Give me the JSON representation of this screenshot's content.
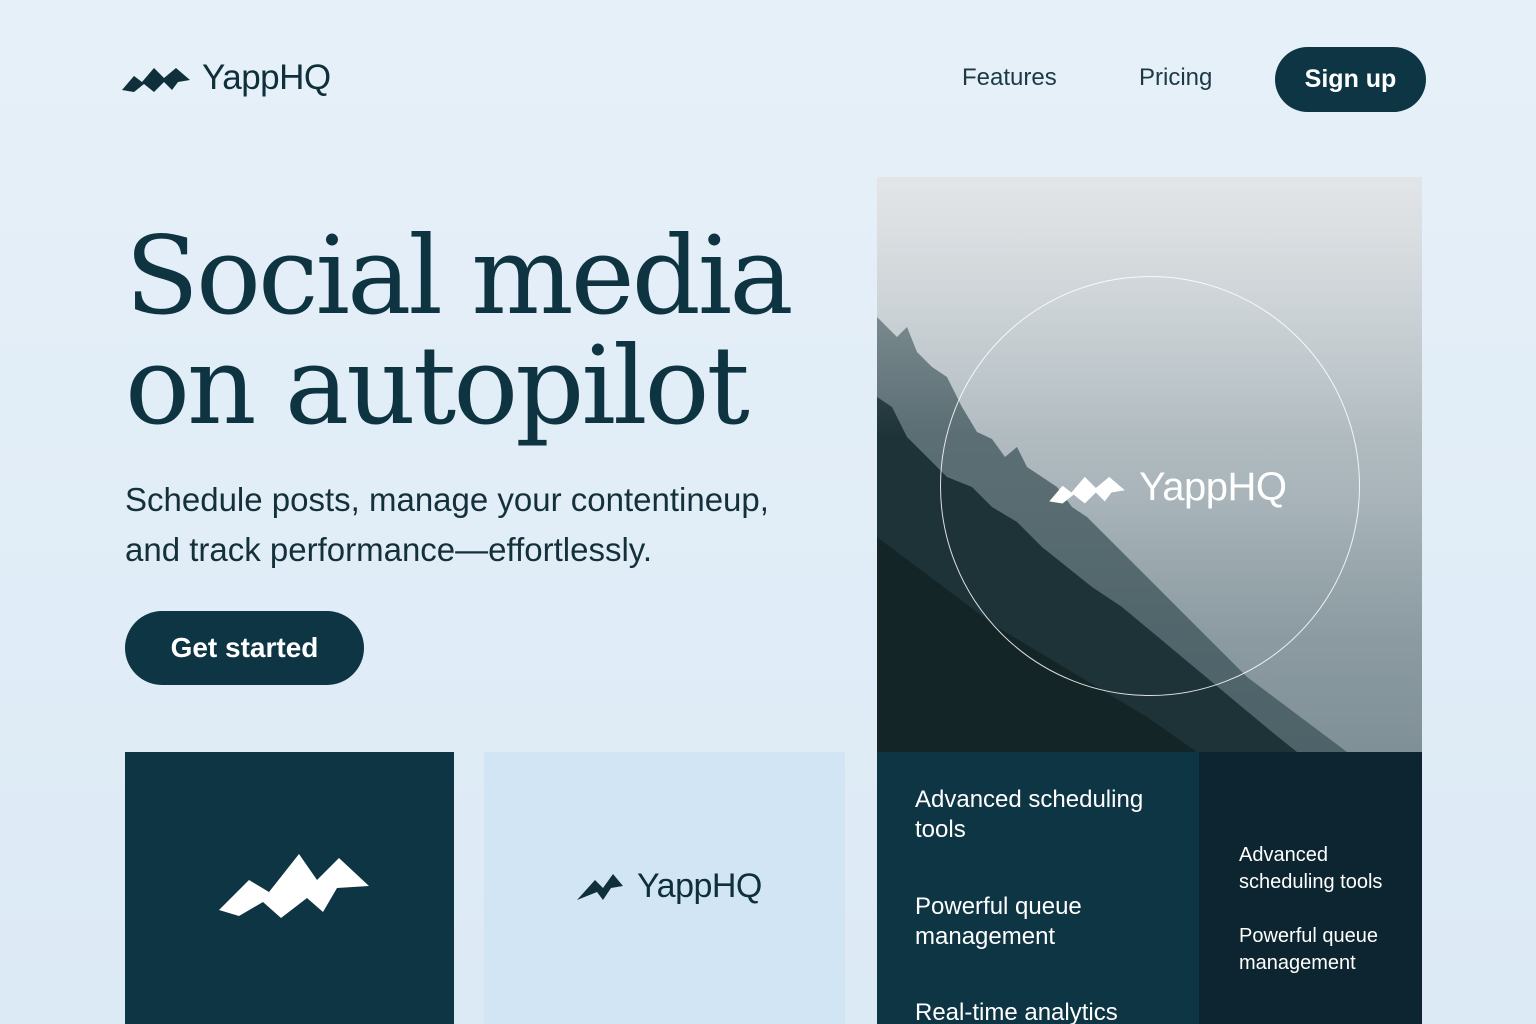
{
  "brand": {
    "name": "YappHQ",
    "primary_color": "#0e3544",
    "background_color": "#e2eef8"
  },
  "nav": {
    "features_label": "Features",
    "pricing_label": "Pricing",
    "signup_label": "Sign up"
  },
  "hero": {
    "headline_line1": "Social media",
    "headline_line2": "on autopilot",
    "subtext_line1": "Schedule posts, manage your contentineup,",
    "subtext_line2": "and track performance—effortlessly.",
    "cta_label": "Get started"
  },
  "photo": {
    "logo_text": "YappHQ",
    "icon": "yapphq-logo-mark"
  },
  "tiles": {
    "light_logo_text": "YappHQ"
  },
  "features_panel": {
    "items": [
      "Advanced scheduling tools",
      "Powerful queue management",
      "Real-time analytics"
    ]
  },
  "features_panel_small": {
    "items": [
      "Advanced scheduling tools",
      "Powerful queue management"
    ]
  }
}
